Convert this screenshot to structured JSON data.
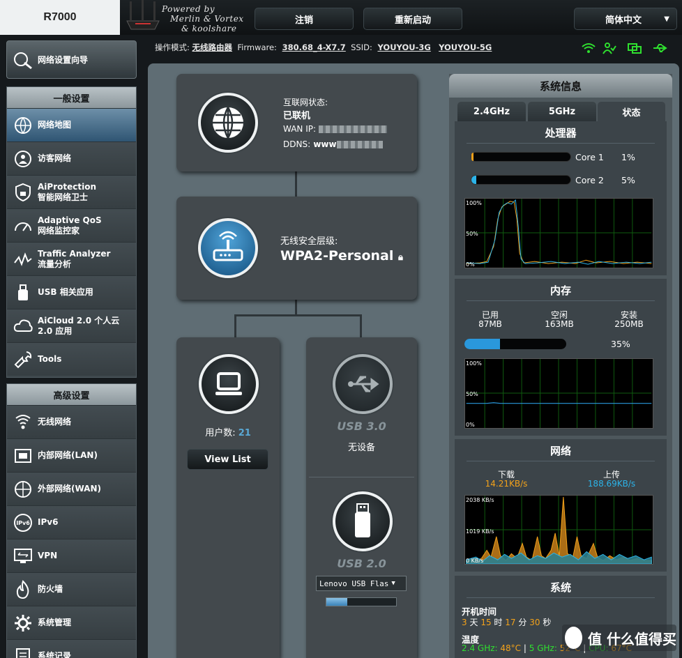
{
  "header": {
    "model": "R7000",
    "powered_by": [
      "Powered by",
      "Merlin & Vortex",
      "& koolshare"
    ],
    "logout": "注销",
    "reboot": "重新启动",
    "language": "简体中文"
  },
  "status_bar": {
    "mode_label": "操作模式:",
    "mode_value": "无线路由器",
    "firmware_label": "Firmware:",
    "firmware_value": "380.68_4-X7.7",
    "ssid_label": "SSID:",
    "ssid_24": "YOUYOU-3G",
    "ssid_5": "YOUYOU-5G"
  },
  "sidebar": {
    "wizard": "网络设置向导",
    "general_title": "一般设置",
    "general_items": [
      {
        "label": "网络地图"
      },
      {
        "label": "访客网络"
      },
      {
        "label": "AiProtection",
        "sub": "智能网络卫士"
      },
      {
        "label": "Adaptive QoS",
        "sub": "网络监控家"
      },
      {
        "label": "Traffic Analyzer",
        "sub": "流量分析"
      },
      {
        "label": "USB 相关应用"
      },
      {
        "label": "AiCloud 2.0 个人云",
        "sub": "2.0 应用"
      },
      {
        "label": "Tools"
      }
    ],
    "advanced_title": "高级设置",
    "advanced_items": [
      {
        "label": "无线网络"
      },
      {
        "label": "内部网络(LAN)"
      },
      {
        "label": "外部网络(WAN)"
      },
      {
        "label": "IPv6"
      },
      {
        "label": "VPN"
      },
      {
        "label": "防火墙"
      },
      {
        "label": "系统管理"
      },
      {
        "label": "系统记录"
      }
    ]
  },
  "map": {
    "internet_status_label": "互联网状态:",
    "internet_status_value": "已联机",
    "wan_ip_label": "WAN IP:",
    "ddns_label": "DDNS:",
    "ddns_value": "www",
    "security_label": "无线安全层级:",
    "security_value": "WPA2-Personal",
    "clients_label": "用户数:",
    "clients_count": "21",
    "view_list": "View List",
    "usb3_label": "USB 3.0",
    "usb3_status": "无设备",
    "usb2_label": "USB 2.0",
    "usb2_device": "Lenovo USB Flas"
  },
  "sysinfo": {
    "title": "系统信息",
    "tabs": [
      "2.4GHz",
      "5GHz",
      "状态"
    ],
    "cpu_title": "处理器",
    "cores": [
      {
        "name": "Core 1",
        "pct": "1%",
        "value": 1
      },
      {
        "name": "Core 2",
        "pct": "5%",
        "value": 5
      }
    ],
    "cpu_graph_labels": [
      "100%",
      "50%",
      "0%"
    ],
    "mem_title": "内存",
    "mem": {
      "used_label": "已用",
      "used": "87MB",
      "free_label": "空闲",
      "free": "163MB",
      "total_label": "安装",
      "total": "250MB",
      "pct": "35%",
      "value": 35
    },
    "mem_graph_labels": [
      "100%",
      "50%",
      "0%"
    ],
    "net_title": "网络",
    "net": {
      "down_label": "下载",
      "down": "14.21KB/s",
      "up_label": "上传",
      "up": "188.69KB/s"
    },
    "net_graph_labels": [
      "2038 KB/s",
      "1019 KB/s",
      "0 KB/s"
    ],
    "sys_title": "系统",
    "uptime_label": "开机时间",
    "uptime": {
      "d": "3",
      "d_unit": "天",
      "h": "15",
      "h_unit": "时",
      "m": "17",
      "m_unit": "分",
      "s": "30",
      "s_unit": "秒"
    },
    "temp_label": "温度",
    "temp": {
      "w24_label": "2.4 GHz:",
      "w24": "48°C",
      "w5_label": "5 GHz:",
      "w5": "52°C",
      "cpu_label": "CPU:",
      "cpu": "67°C"
    }
  },
  "watermark": "值 什么值得买",
  "colors": {
    "accent_orange": "#f3a21a",
    "accent_cyan": "#2cb3e8",
    "status_green": "#2fe02f"
  }
}
